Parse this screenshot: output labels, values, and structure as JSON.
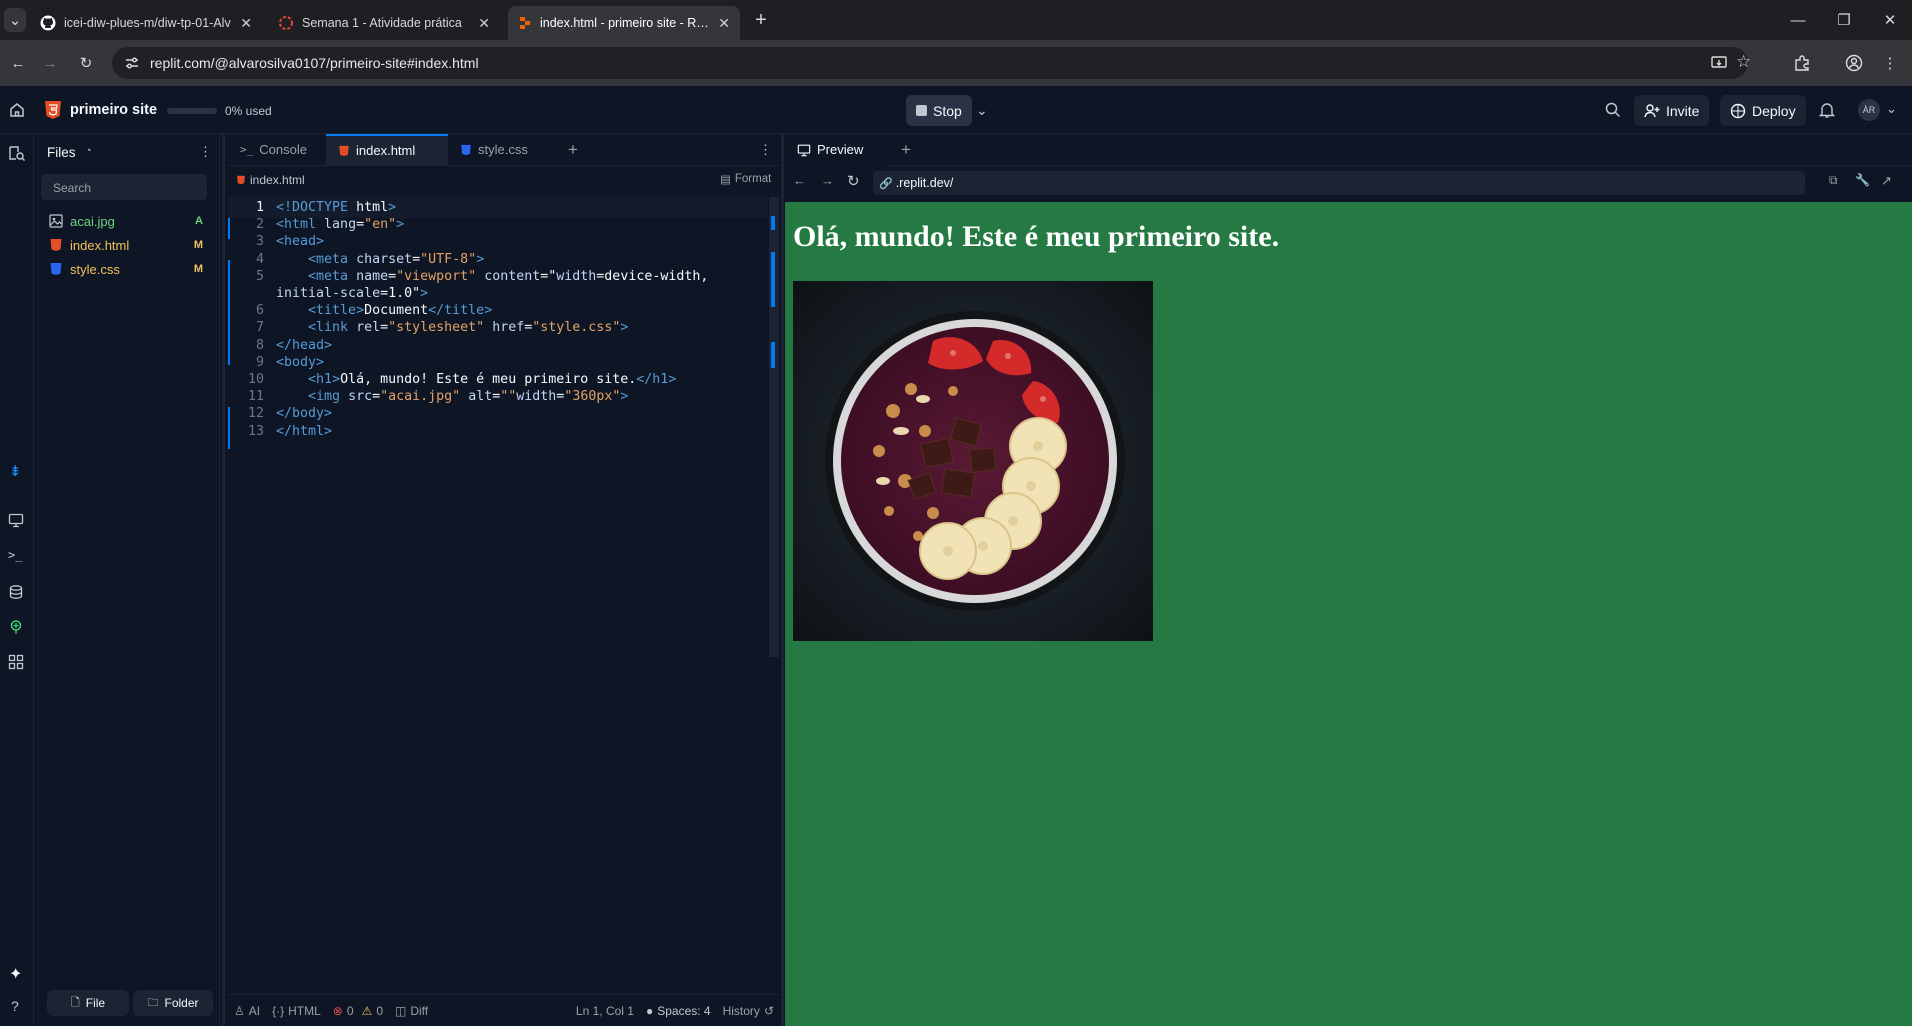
{
  "browser": {
    "tabs": [
      {
        "title": "icei-diw-plues-m/diw-tp-01-Alv",
        "icon": "github-icon"
      },
      {
        "title": "Semana 1 - Atividade prática",
        "icon": "loading-icon"
      },
      {
        "title": "index.html - primeiro site - Repl",
        "icon": "replit-icon"
      }
    ],
    "url": "replit.com/@alvarosilva0107/primeiro-site#index.html"
  },
  "header": {
    "project_name": "primeiro site",
    "storage": "0% used",
    "stop_label": "Stop",
    "invite_label": "Invite",
    "deploy_label": "Deploy",
    "avatar": "ÀR"
  },
  "files": {
    "title": "Files",
    "search_placeholder": "Search",
    "items": [
      {
        "name": "acai.jpg",
        "badge": "A",
        "color": "#6dd37e"
      },
      {
        "name": "index.html",
        "badge": "M",
        "color": "#f2c25c"
      },
      {
        "name": "style.css",
        "badge": "M",
        "color": "#f2c25c"
      }
    ],
    "new_file": "File",
    "new_folder": "Folder"
  },
  "editor": {
    "tabs": [
      "Console",
      "index.html",
      "style.css"
    ],
    "breadcrumb": "index.html",
    "format_label": "Format",
    "line_numbers": [
      "1",
      "2",
      "3",
      "4",
      "5",
      "",
      "6",
      "7",
      "8",
      "9",
      "10",
      "11",
      "12",
      "13"
    ],
    "code": [
      "<!DOCTYPE html>",
      "<html lang=\"en\">",
      "<head>",
      "    <meta charset=\"UTF-8\">",
      "    <meta name=\"viewport\" content=\"width=device-width,",
      "initial-scale=1.0\">",
      "    <title>Document</title>",
      "    <link rel=\"stylesheet\" href=\"style.css\">",
      "</head>",
      "<body>",
      "    <h1>Olá, mundo! Este é meu primeiro site.</h1>",
      "    <img src=\"acai.jpg\" alt=\"\"width=\"360px\">",
      "</body>",
      "</html>"
    ],
    "status": {
      "ai": "AI",
      "lang": "HTML",
      "errors": "0",
      "warnings": "0",
      "diff": "Diff",
      "cursor": "Ln 1, Col 1",
      "spaces": "Spaces: 4",
      "history": "History"
    }
  },
  "preview": {
    "tab": "Preview",
    "url": ".replit.dev/",
    "heading": "Olá, mundo! Este é meu primeiro site.",
    "background": "#247a42"
  }
}
